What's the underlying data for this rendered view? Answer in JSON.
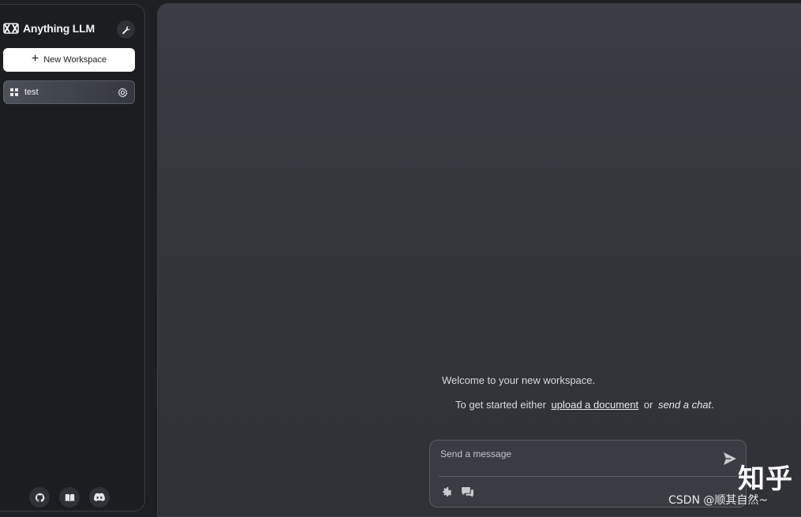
{
  "app": {
    "name": "Anything LLM"
  },
  "sidebar": {
    "new_workspace_label": "New Workspace",
    "workspaces": [
      {
        "label": "test"
      }
    ],
    "footer_icons": [
      "github-icon",
      "docs-book-icon",
      "discord-icon"
    ]
  },
  "main": {
    "welcome_line1": "Welcome to your new workspace.",
    "welcome_prefix": "To get started either",
    "upload_link": "upload a document",
    "or_text": "or",
    "chat_link": "send a chat",
    "period": "."
  },
  "composer": {
    "placeholder": "Send a message",
    "value": ""
  },
  "watermark": {
    "big": "知乎",
    "small": "CSDN @顺其自然~"
  },
  "colors": {
    "background": "#1e1f22",
    "sidebar": "#1c1d21",
    "main_panel": "#3a3d44",
    "button_white": "#ffffff",
    "accent_text": "#e6e7ea"
  }
}
